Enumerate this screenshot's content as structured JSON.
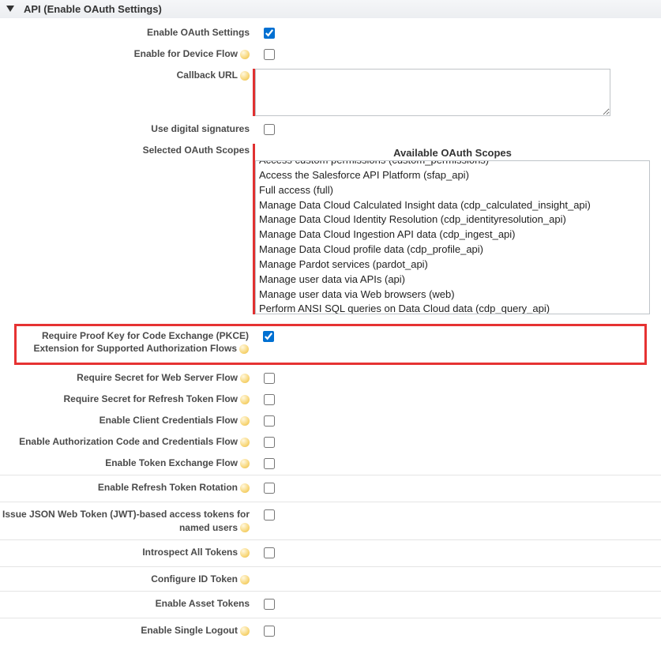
{
  "section_title": "API (Enable OAuth Settings)",
  "fields": {
    "enable_oauth": "Enable OAuth Settings",
    "device_flow": "Enable for Device Flow",
    "callback_url": "Callback URL",
    "digital_sig": "Use digital signatures",
    "scopes_label": "Selected OAuth Scopes",
    "scopes_title": "Available OAuth Scopes",
    "pkce": "Require Proof Key for Code Exchange (PKCE) Extension for Supported Authorization Flows",
    "secret_web": "Require Secret for Web Server Flow",
    "secret_refresh": "Require Secret for Refresh Token Flow",
    "client_cred": "Enable Client Credentials Flow",
    "auth_code_cred": "Enable Authorization Code and Credentials Flow",
    "token_exchange": "Enable Token Exchange Flow",
    "refresh_rotation": "Enable Refresh Token Rotation",
    "jwt": "Issue JSON Web Token (JWT)-based access tokens for named users",
    "introspect": "Introspect All Tokens",
    "id_token": "Configure ID Token",
    "asset_tokens": "Enable Asset Tokens",
    "single_logout": "Enable Single Logout"
  },
  "scopes": [
    "Access custom permissions (custom_permissions)",
    "Access the Salesforce API Platform (sfap_api)",
    "Full access (full)",
    "Manage Data Cloud Calculated Insight data (cdp_calculated_insight_api)",
    "Manage Data Cloud Identity Resolution (cdp_identityresolution_api)",
    "Manage Data Cloud Ingestion API data (cdp_ingest_api)",
    "Manage Data Cloud profile data (cdp_profile_api)",
    "Manage Pardot services (pardot_api)",
    "Manage user data via APIs (api)",
    "Manage user data via Web browsers (web)",
    "Perform ANSI SQL queries on Data Cloud data (cdp_query_api)"
  ],
  "checked": {
    "enable_oauth": true,
    "pkce": true
  }
}
